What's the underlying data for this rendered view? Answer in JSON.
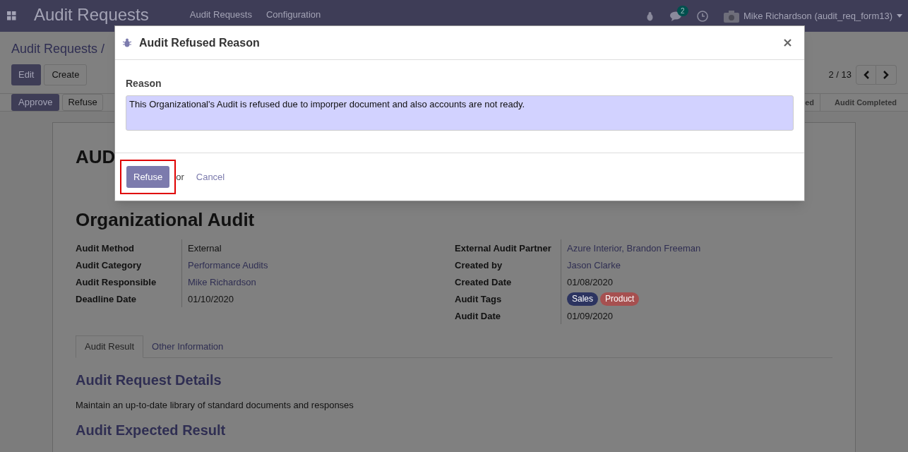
{
  "navbar": {
    "app_title": "Audit Requests",
    "menu": [
      "Audit Requests",
      "Configuration"
    ],
    "message_count": "2",
    "user": "Mike Richardson (audit_req_form13)"
  },
  "control_panel": {
    "breadcrumb": "Audit Requests /",
    "buttons": [
      "Edit",
      "Create"
    ],
    "pager": "2 / 13",
    "actions": [
      "Approve",
      "Refuse"
    ],
    "stages": [
      {
        "label": "ed",
        "selected": false
      },
      {
        "label": "Audit Completed",
        "selected": false
      }
    ]
  },
  "sheet": {
    "title_lines": [
      "AUD",
      "Organizational Audit"
    ],
    "left_fields": [
      {
        "label": "Audit Method",
        "value": "External",
        "link": false
      },
      {
        "label": "Audit Category",
        "value": "Performance Audits",
        "link": true
      },
      {
        "label": "Audit Responsible",
        "value": "Mike Richardson",
        "link": true
      },
      {
        "label": "Deadline Date",
        "value": "01/10/2020",
        "link": false
      }
    ],
    "right_fields": [
      {
        "label": "External Audit Partner",
        "value": "Azure Interior, Brandon Freeman",
        "link": true
      },
      {
        "label": "Created by",
        "value": "Jason Clarke",
        "link": true
      },
      {
        "label": "Created Date",
        "value": "01/08/2020",
        "link": false
      },
      {
        "label": "Audit Tags",
        "tags": [
          {
            "label": "Sales",
            "color": "#2c3460"
          },
          {
            "label": "Product",
            "color": "#a65050"
          }
        ]
      },
      {
        "label": "Audit Date",
        "value": "01/09/2020",
        "link": false
      }
    ],
    "tabs": [
      {
        "label": "Audit Result",
        "selected": true
      },
      {
        "label": "Other Information",
        "selected": false
      }
    ],
    "sections": [
      {
        "heading": "Audit Request Details",
        "text": "Maintain an up-to-date library of standard documents and responses"
      },
      {
        "heading": "Audit Expected Result"
      }
    ]
  },
  "dialog": {
    "title": "Audit Refused Reason",
    "field_label": "Reason",
    "reason": "This Organizational's Audit is refused due to imporper document and also accounts are not ready.",
    "primary_button": "Refuse",
    "highlighted": true,
    "or_text": "or",
    "cancel": "Cancel"
  }
}
